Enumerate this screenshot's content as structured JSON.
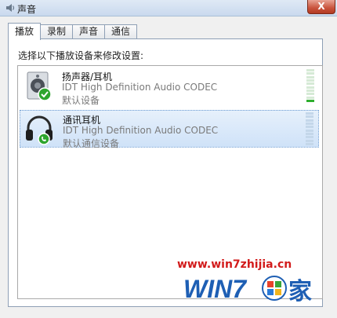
{
  "window": {
    "title": "声音",
    "close_label": "X"
  },
  "tabs": [
    {
      "label": "播放",
      "active": true
    },
    {
      "label": "录制",
      "active": false
    },
    {
      "label": "声音",
      "active": false
    },
    {
      "label": "通信",
      "active": false
    }
  ],
  "instruction": "选择以下播放设备来修改设置:",
  "devices": [
    {
      "name": "扬声器/耳机",
      "driver": "IDT High Definition Audio CODEC",
      "status": "默认设备",
      "icon": "speaker-icon",
      "badge": "green-check-badge",
      "selected": false,
      "level": 0.05
    },
    {
      "name": "通讯耳机",
      "driver": "IDT High Definition Audio CODEC",
      "status": "默认通信设备",
      "icon": "headphones-icon",
      "badge": "green-phone-badge",
      "selected": true,
      "level": 0
    }
  ],
  "watermark": {
    "url": "www.win7zhijia.cn",
    "logo_text": "WIN7之家"
  },
  "colors": {
    "selection_bg": "#cfe2f8",
    "meter_green": "#2fae2f",
    "watermark_red": "#d21b1b"
  }
}
